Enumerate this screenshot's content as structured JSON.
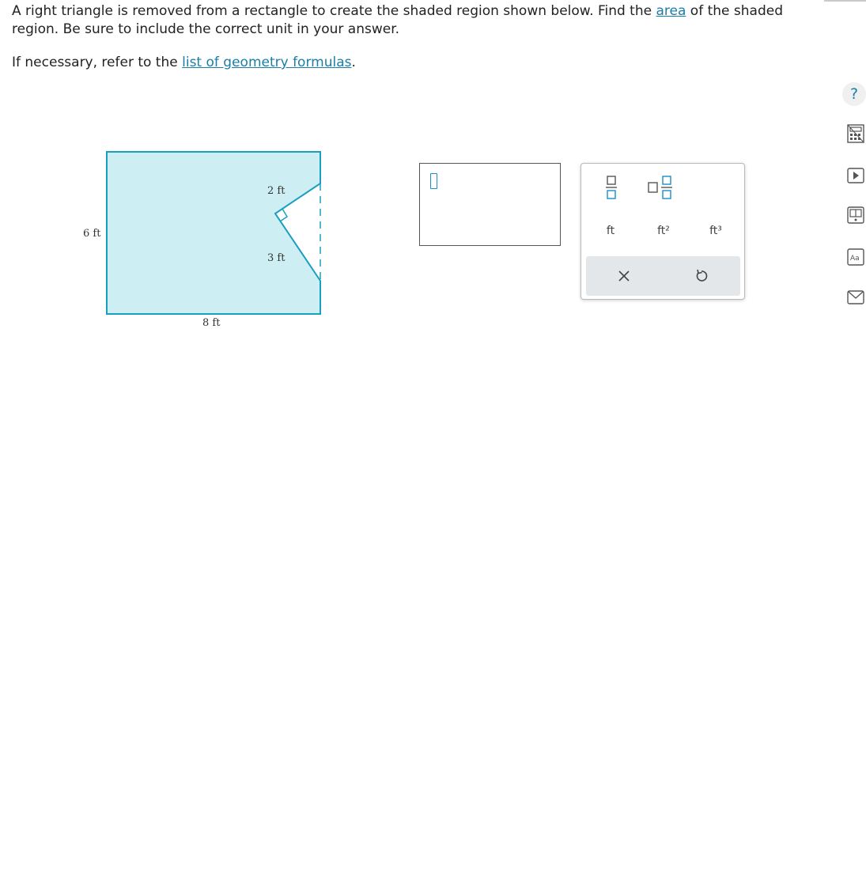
{
  "question": {
    "line1_before": "A right triangle is removed from a rectangle to create the shaded region shown below. Find the ",
    "line1_link": "area",
    "line1_after": " of the shaded region. Be sure to include the correct unit in your answer.",
    "line2_before": "If necessary, refer to the ",
    "line2_link": "list of geometry formulas",
    "line2_after": "."
  },
  "figure": {
    "label_top_leg": "2 ft",
    "label_bottom_leg": "3 ft",
    "label_height": "6 ft",
    "label_width": "8 ft",
    "fill_color": "#cdeef3",
    "stroke_color": "#1a9fbf"
  },
  "answer": {
    "value": ""
  },
  "palette": {
    "units": [
      "ft",
      "ft²",
      "ft³"
    ],
    "clear_icon": "times-icon",
    "undo_icon": "undo-icon",
    "fraction_icon": "fraction-icon",
    "mixed_number_icon": "mixed-number-icon"
  },
  "toolbar": {
    "help_label": "?",
    "icons": [
      "calculator-icon",
      "video-icon",
      "textbook-icon",
      "glossary-icon",
      "email-icon"
    ]
  },
  "colors": {
    "link": "#1a7ea8",
    "accent": "#1a9fbf"
  }
}
